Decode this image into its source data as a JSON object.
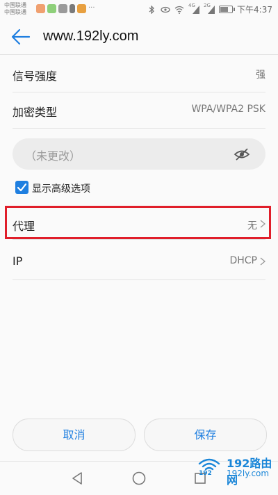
{
  "status_bar": {
    "carrier_1": "中国联通",
    "carrier_2": "中国联通",
    "net_1": "4G",
    "net_2": "2G",
    "time": "下午4:37",
    "battery_level": 0.6
  },
  "header": {
    "title": "www.192ly.com"
  },
  "rows": {
    "signal": {
      "label": "信号强度",
      "value": "强"
    },
    "encryption": {
      "label": "加密类型",
      "value": "WPA/WPA2 PSK"
    },
    "proxy": {
      "label": "代理",
      "value": "无"
    },
    "ip": {
      "label": "IP",
      "value": "DHCP"
    }
  },
  "password": {
    "placeholder": "（未更改）"
  },
  "advanced": {
    "label": "显示高级选项",
    "checked": true
  },
  "buttons": {
    "cancel": "取消",
    "save": "保存"
  },
  "watermark": {
    "name": "192路由网",
    "url": "192ly.com",
    "prefix": "192"
  },
  "colors": {
    "accent": "#1f7fe0",
    "highlight": "#e01e2a"
  }
}
